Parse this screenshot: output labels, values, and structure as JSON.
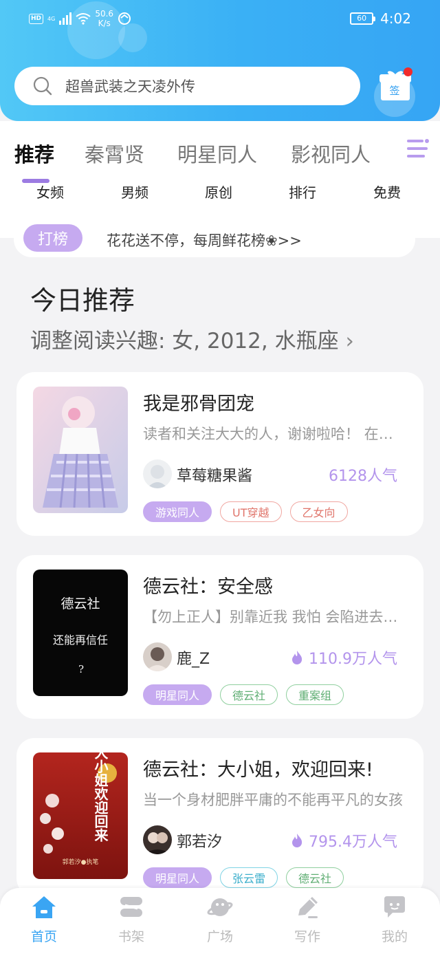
{
  "status_bar": {
    "hd": "HD",
    "network": "4G",
    "speed_value": "50.6",
    "speed_unit": "K/s",
    "battery": "60",
    "time": "4:02"
  },
  "search": {
    "placeholder": "超兽武装之天凌外传"
  },
  "checkin": {
    "label": "签"
  },
  "tabs": [
    {
      "label": "推荐",
      "active": true
    },
    {
      "label": "秦霄贤"
    },
    {
      "label": "明星同人"
    },
    {
      "label": "影视同人"
    }
  ],
  "subtabs": [
    {
      "label": "女频",
      "active": true
    },
    {
      "label": "男频"
    },
    {
      "label": "原创"
    },
    {
      "label": "排行"
    },
    {
      "label": "免费"
    }
  ],
  "banner": {
    "tag": "打榜",
    "text": "花花送不停，每周鲜花榜❀>>"
  },
  "section": {
    "title": "今日推荐",
    "subtitle": "调整阅读兴趣: 女, 2012, 水瓶座",
    "chevron": "›"
  },
  "books": [
    {
      "title": "我是邪骨团宠",
      "desc": "读者和关注大大的人，谢谢啦哈！ 在这里祝大家身体健康",
      "author": "草莓糖果酱",
      "popularity": "6128人气",
      "hot": false,
      "tags": [
        {
          "label": "游戏同人",
          "style": "fill"
        },
        {
          "label": "UT穿越",
          "style": "red"
        },
        {
          "label": "乙女向",
          "style": "red"
        }
      ]
    },
    {
      "title": "德云社：安全感",
      "desc": "【勿上正人】别靠近我 我怕 会陷进去出不来",
      "author": "鹿_Z",
      "popularity": "110.9万人气",
      "hot": true,
      "tags": [
        {
          "label": "明星同人",
          "style": "fill"
        },
        {
          "label": "德云社",
          "style": "green"
        },
        {
          "label": "重案组",
          "style": "green"
        }
      ]
    },
    {
      "title": "德云社：大小姐，欢迎回来!",
      "desc": "当一个身材肥胖平庸的不能再平凡的女孩",
      "author": "郭若汐",
      "popularity": "795.4万人气",
      "hot": true,
      "tags": [
        {
          "label": "明星同人",
          "style": "fill"
        },
        {
          "label": "张云雷",
          "style": "cyan"
        },
        {
          "label": "德云社",
          "style": "green"
        }
      ]
    }
  ],
  "cover2_text": {
    "line1": "德云社",
    "line2": "还能再信任",
    "mark": "?"
  },
  "cover3_text": {
    "title": "大小姐欢迎回来",
    "author": "郭若汐●执笔"
  },
  "bottom_nav": [
    {
      "label": "首页",
      "icon": "home-icon",
      "active": true
    },
    {
      "label": "书架",
      "icon": "bookshelf-icon"
    },
    {
      "label": "广场",
      "icon": "planet-icon"
    },
    {
      "label": "写作",
      "icon": "pen-icon"
    },
    {
      "label": "我的",
      "icon": "chat-bubble-icon"
    }
  ],
  "colors": {
    "accent": "#3aa5f3",
    "purple": "#c6aaf0",
    "popularity": "#b394ec"
  }
}
